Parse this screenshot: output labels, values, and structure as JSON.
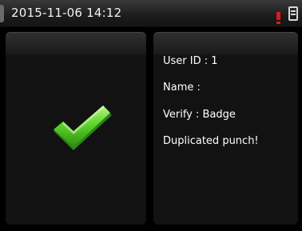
{
  "status_bar": {
    "datetime": "2015-11-06 14:12",
    "alert_icon": "exclamation-icon",
    "device_icon": "device-icon",
    "alert_color": "#e01818"
  },
  "result": {
    "icon": "checkmark-icon",
    "icon_color": "#5fd42a"
  },
  "info": {
    "user_id": "User ID : 1",
    "name": "Name :",
    "verify": "Verify : Badge",
    "message": "Duplicated punch!"
  }
}
